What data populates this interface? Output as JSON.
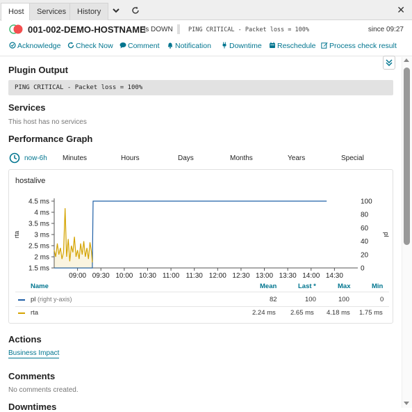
{
  "tabs": [
    {
      "label": "Host",
      "active": true
    },
    {
      "label": "Services",
      "active": false
    },
    {
      "label": "History",
      "active": false
    }
  ],
  "tab_icons": [
    "chevron-down-icon",
    "refresh-icon"
  ],
  "close_icon": "close-icon",
  "host": {
    "name": "001-002-DEMO-HOSTNAME",
    "state": "is DOWN",
    "plugin_output_short": "PING CRITICAL - Packet loss = 100%",
    "since": "since 09:27",
    "state_color": "#f34f4f",
    "toggle_color": "#44bb77"
  },
  "actions": [
    {
      "label": "Acknowledge",
      "icon": "check-circle-icon"
    },
    {
      "label": "Check Now",
      "icon": "refresh-icon"
    },
    {
      "label": "Comment",
      "icon": "comment-icon"
    },
    {
      "label": "Notification",
      "icon": "bell-icon"
    },
    {
      "label": "Downtime",
      "icon": "plug-icon"
    },
    {
      "label": "Reschedule",
      "icon": "calendar-icon"
    },
    {
      "label": "Process check result",
      "icon": "edit-icon"
    }
  ],
  "sections": {
    "plugin_output": {
      "title": "Plugin Output",
      "text": "PING CRITICAL - Packet loss = 100%"
    },
    "services": {
      "title": "Services",
      "empty": "This host has no services"
    },
    "performance": {
      "title": "Performance Graph"
    },
    "actions": {
      "title": "Actions",
      "link": "Business Impact"
    },
    "comments": {
      "title": "Comments",
      "empty": "No comments created."
    },
    "downtimes": {
      "title": "Downtimes"
    }
  },
  "time_ranges": [
    "now-6h",
    "Minutes",
    "Hours",
    "Days",
    "Months",
    "Years",
    "Special"
  ],
  "accent_color": "#00758f",
  "chart_data": {
    "type": "line",
    "title": "hostalive",
    "x": [
      "09:00",
      "09:30",
      "10:00",
      "10:30",
      "11:00",
      "11:30",
      "12:00",
      "12:30",
      "13:00",
      "13:30",
      "14:00",
      "14:30"
    ],
    "ylabel": "rta",
    "y2label": "pl",
    "yticks": [
      "1.5 ms",
      "2 ms",
      "2.5 ms",
      "3 ms",
      "3.5 ms",
      "4 ms",
      "4.5 ms"
    ],
    "ylim": [
      1.5,
      4.5
    ],
    "y2ticks": [
      "0",
      "20",
      "40",
      "60",
      "80",
      "100"
    ],
    "y2lim": [
      0,
      100
    ],
    "xlim_minutes": [
      510,
      900
    ],
    "series": [
      {
        "name": "pl",
        "axis": "right",
        "color": "#1f5fa6",
        "points": [
          [
            510,
            0
          ],
          [
            559,
            0
          ],
          [
            560,
            100
          ],
          [
            860,
            100
          ]
        ]
      },
      {
        "name": "rta",
        "axis": "left",
        "color": "#d4a300",
        "points": [
          [
            510,
            2.3
          ],
          [
            512,
            2.0
          ],
          [
            514,
            2.6
          ],
          [
            516,
            2.1
          ],
          [
            518,
            2.4
          ],
          [
            520,
            1.9
          ],
          [
            522,
            2.2
          ],
          [
            524,
            4.18
          ],
          [
            526,
            2.0
          ],
          [
            528,
            2.8
          ],
          [
            530,
            1.8
          ],
          [
            532,
            2.5
          ],
          [
            534,
            2.2
          ],
          [
            536,
            2.9
          ],
          [
            538,
            2.0
          ],
          [
            540,
            2.3
          ],
          [
            542,
            1.9
          ],
          [
            544,
            2.6
          ],
          [
            546,
            2.1
          ],
          [
            548,
            2.7
          ],
          [
            550,
            2.0
          ],
          [
            552,
            2.4
          ],
          [
            554,
            1.9
          ],
          [
            556,
            2.65
          ],
          [
            558,
            2.2
          ],
          [
            559,
            1.75
          ]
        ]
      }
    ],
    "legend": {
      "headers": [
        "Name",
        "Mean",
        "Last *",
        "Max",
        "Min"
      ],
      "rows": [
        {
          "name": "pl",
          "note": "(right y-axis)",
          "color": "#1f5fa6",
          "mean": "82",
          "last": "100",
          "max": "100",
          "min": "0"
        },
        {
          "name": "rta",
          "note": "",
          "color": "#d4a300",
          "mean": "2.24 ms",
          "last": "2.65 ms",
          "max": "4.18 ms",
          "min": "1.75 ms"
        }
      ]
    }
  }
}
